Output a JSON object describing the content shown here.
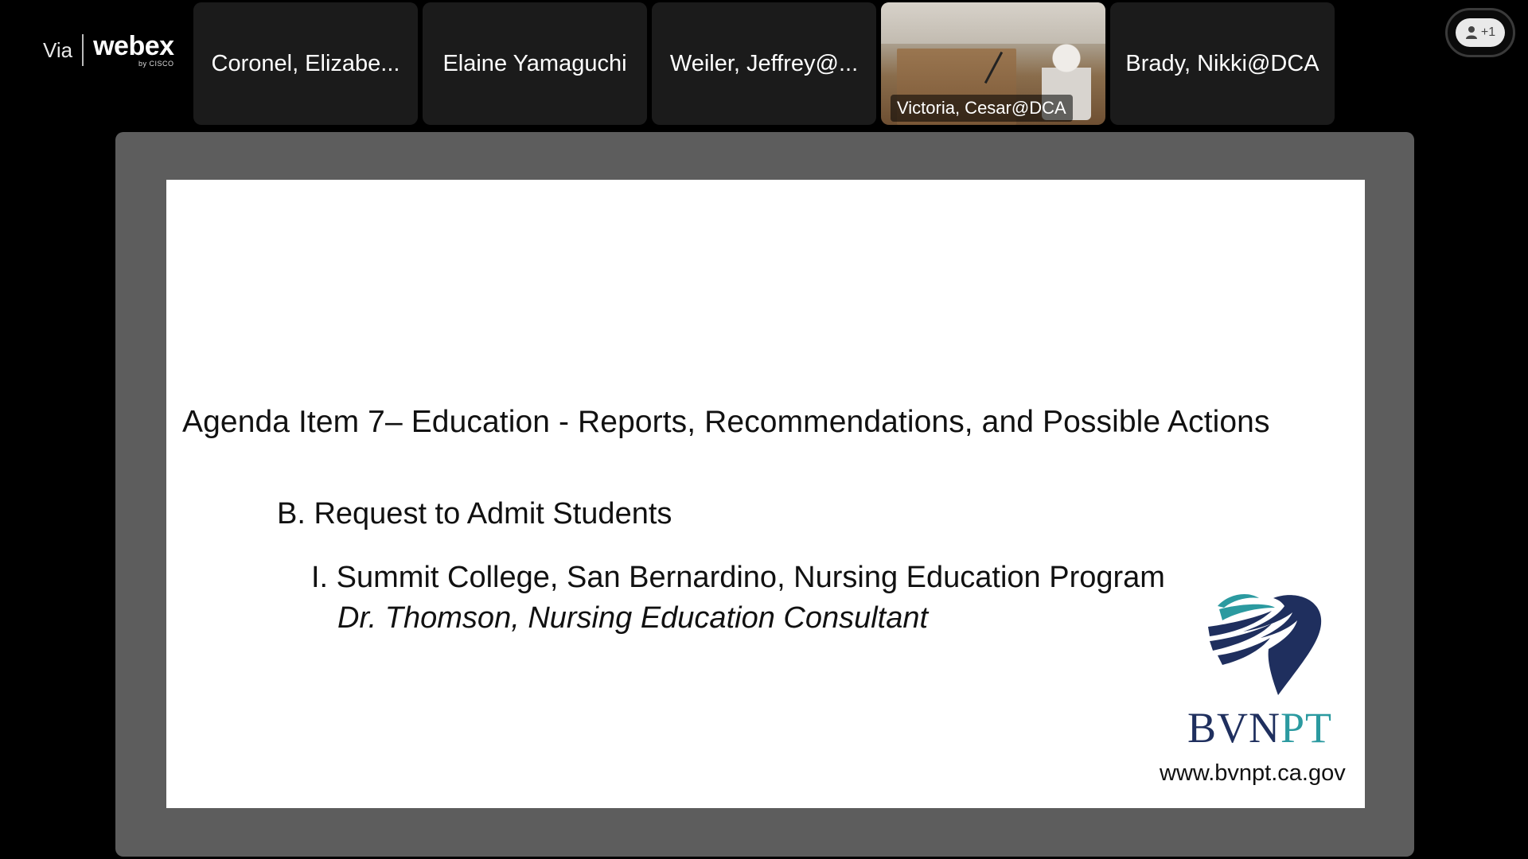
{
  "branding": {
    "via": "Via",
    "product": "webex",
    "byline": "by CISCO"
  },
  "participants": [
    {
      "name": "Coronel, Elizabe...",
      "has_video": false
    },
    {
      "name": "Elaine Yamaguchi",
      "has_video": false
    },
    {
      "name": "Weiler, Jeffrey@...",
      "has_video": false
    },
    {
      "name": "Victoria, Cesar@DCA",
      "has_video": true
    },
    {
      "name": "Brady, Nikki@DCA",
      "has_video": false
    }
  ],
  "overflow_participants": "+1",
  "slide": {
    "title": "Agenda Item 7– Education - Reports, Recommendations, and Possible Actions",
    "subheading": "B. Request to Admit Students",
    "item": "I. Summit College, San Bernardino, Nursing Education Program",
    "presenter": "Dr. Thomson, Nursing Education Consultant",
    "logo_text_part1": "BVN",
    "logo_text_part2": "PT",
    "url": "www.bvnpt.ca.gov",
    "colors": {
      "logo_navy": "#1f2f5e",
      "logo_teal": "#2b9aa0"
    }
  }
}
